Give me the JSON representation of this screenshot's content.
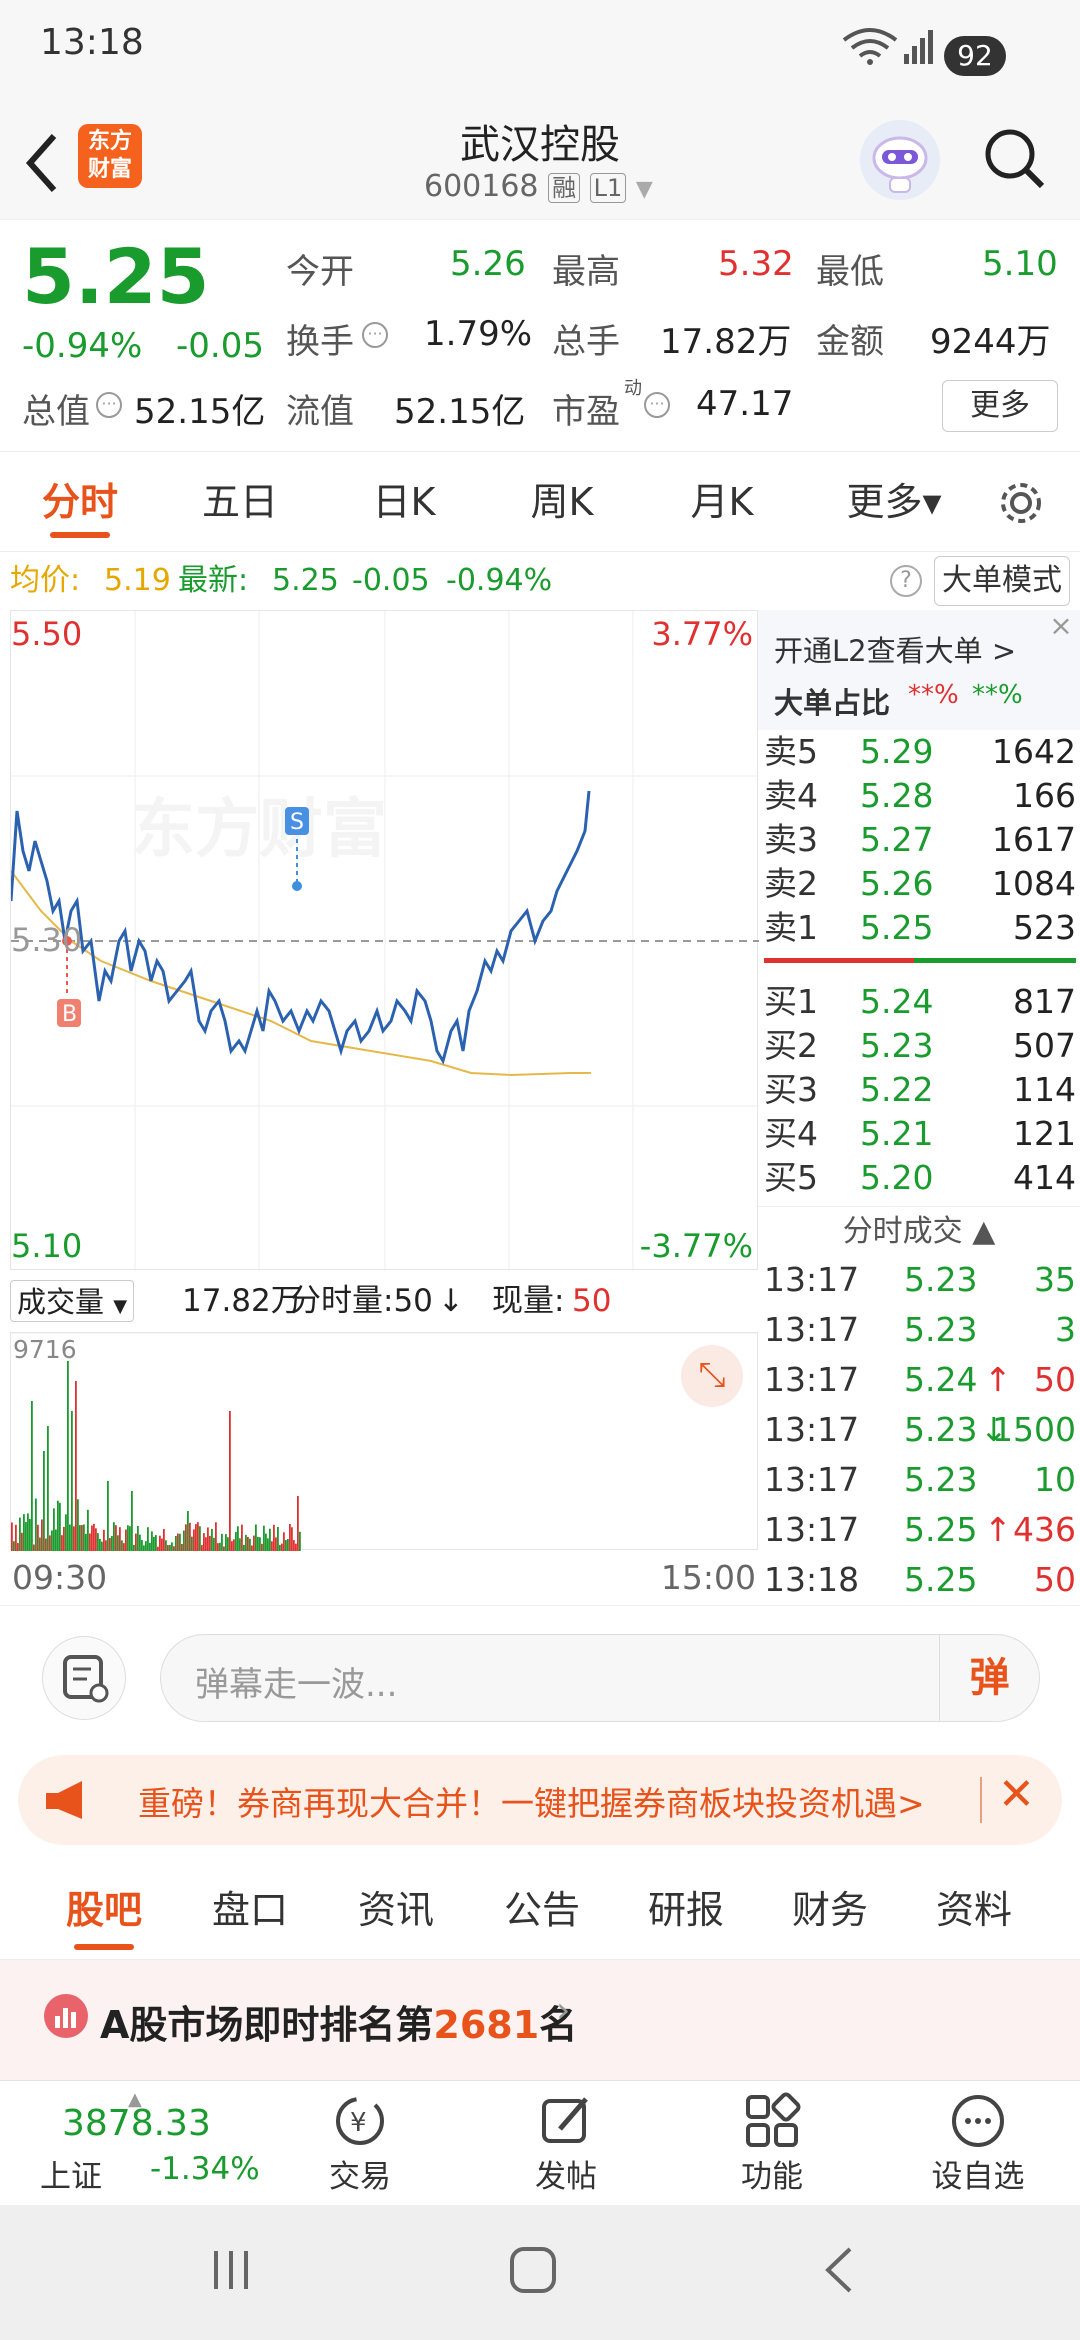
{
  "status": {
    "time": "13:18",
    "battery": "92"
  },
  "header": {
    "title": "武汉控股",
    "code": "600168",
    "tag1": "融",
    "tag2": "L1",
    "logo_top": "东方",
    "logo_bottom": "财富"
  },
  "quote": {
    "price": "5.25",
    "pct": "-0.94%",
    "chg": "-0.05",
    "open_label": "今开",
    "open": "5.26",
    "high_label": "最高",
    "high": "5.32",
    "low_label": "最低",
    "low": "5.10",
    "turnover_label": "换手",
    "turnover": "1.79%",
    "vol_label": "总手",
    "vol": "17.82万",
    "amount_label": "金额",
    "amount": "9244万",
    "mcap_label": "总值",
    "mcap": "52.15亿",
    "float_label": "流值",
    "float": "52.15亿",
    "pe_label": "市盈",
    "pe_sup": "动",
    "pe": "47.17",
    "more": "更多"
  },
  "tabs": [
    "分时",
    "五日",
    "日K",
    "周K",
    "月K",
    "更多▾"
  ],
  "pricebar": {
    "avg_label": "均价:",
    "avg": "5.19",
    "latest_label": "最新:",
    "latest": "5.25",
    "chg": "-0.05",
    "pct": "-0.94%",
    "mode": "大单模式"
  },
  "chart": {
    "ymax": "5.50",
    "ymin": "5.10",
    "pmax": "3.77%",
    "pmin": "-3.77%",
    "mid": "5.30",
    "watermark": "东方财富",
    "buy_tag": "B",
    "sell_tag": "S"
  },
  "side": {
    "l2": "开通L2查看大单 >",
    "ratio_label": "大单占比",
    "ratio_red": "**%",
    "ratio_green": "**%",
    "asks": [
      {
        "l": "卖5",
        "p": "5.29",
        "v": "1642"
      },
      {
        "l": "卖4",
        "p": "5.28",
        "v": "166"
      },
      {
        "l": "卖3",
        "p": "5.27",
        "v": "1617"
      },
      {
        "l": "卖2",
        "p": "5.26",
        "v": "1084"
      },
      {
        "l": "卖1",
        "p": "5.25",
        "v": "523"
      }
    ],
    "bids": [
      {
        "l": "买1",
        "p": "5.24",
        "v": "817"
      },
      {
        "l": "买2",
        "p": "5.23",
        "v": "507"
      },
      {
        "l": "买3",
        "p": "5.22",
        "v": "114"
      },
      {
        "l": "买4",
        "p": "5.21",
        "v": "121"
      },
      {
        "l": "买5",
        "p": "5.20",
        "v": "414"
      }
    ],
    "trades_title": "分时成交",
    "trades": [
      {
        "t": "13:17",
        "p": "5.23",
        "a": "",
        "v": "35"
      },
      {
        "t": "13:17",
        "p": "5.23",
        "a": "",
        "v": "3"
      },
      {
        "t": "13:17",
        "p": "5.24",
        "a": "↑",
        "v": "50"
      },
      {
        "t": "13:17",
        "p": "5.23",
        "a": "↓",
        "v": "1500"
      },
      {
        "t": "13:17",
        "p": "5.23",
        "a": "",
        "v": "10"
      },
      {
        "t": "13:17",
        "p": "5.25",
        "a": "↑",
        "v": "436"
      },
      {
        "t": "13:18",
        "p": "5.25",
        "a": "",
        "v": "50"
      }
    ]
  },
  "volbar": {
    "type": "成交量",
    "total": "17.82万",
    "period": "分时量:50",
    "now_label": "现量:",
    "now": "50",
    "max": "9716"
  },
  "timeaxis": {
    "start": "09:30",
    "end": "15:00"
  },
  "danmu": {
    "placeholder": "弹幕走一波...",
    "btn": "弹"
  },
  "notice": {
    "text": "重磅！券商再现大合并！一键把握券商板块投资机遇>"
  },
  "newstabs": [
    "股吧",
    "盘口",
    "资讯",
    "公告",
    "研报",
    "财务",
    "资料"
  ],
  "rank": {
    "pre": "A股市场即时排名第",
    "num": "2681",
    "post": "名"
  },
  "bottom": {
    "index_val": "3878.33",
    "index_name": "上证",
    "index_pct": "-1.34%",
    "items": [
      "交易",
      "发帖",
      "功能",
      "设自选"
    ]
  }
}
